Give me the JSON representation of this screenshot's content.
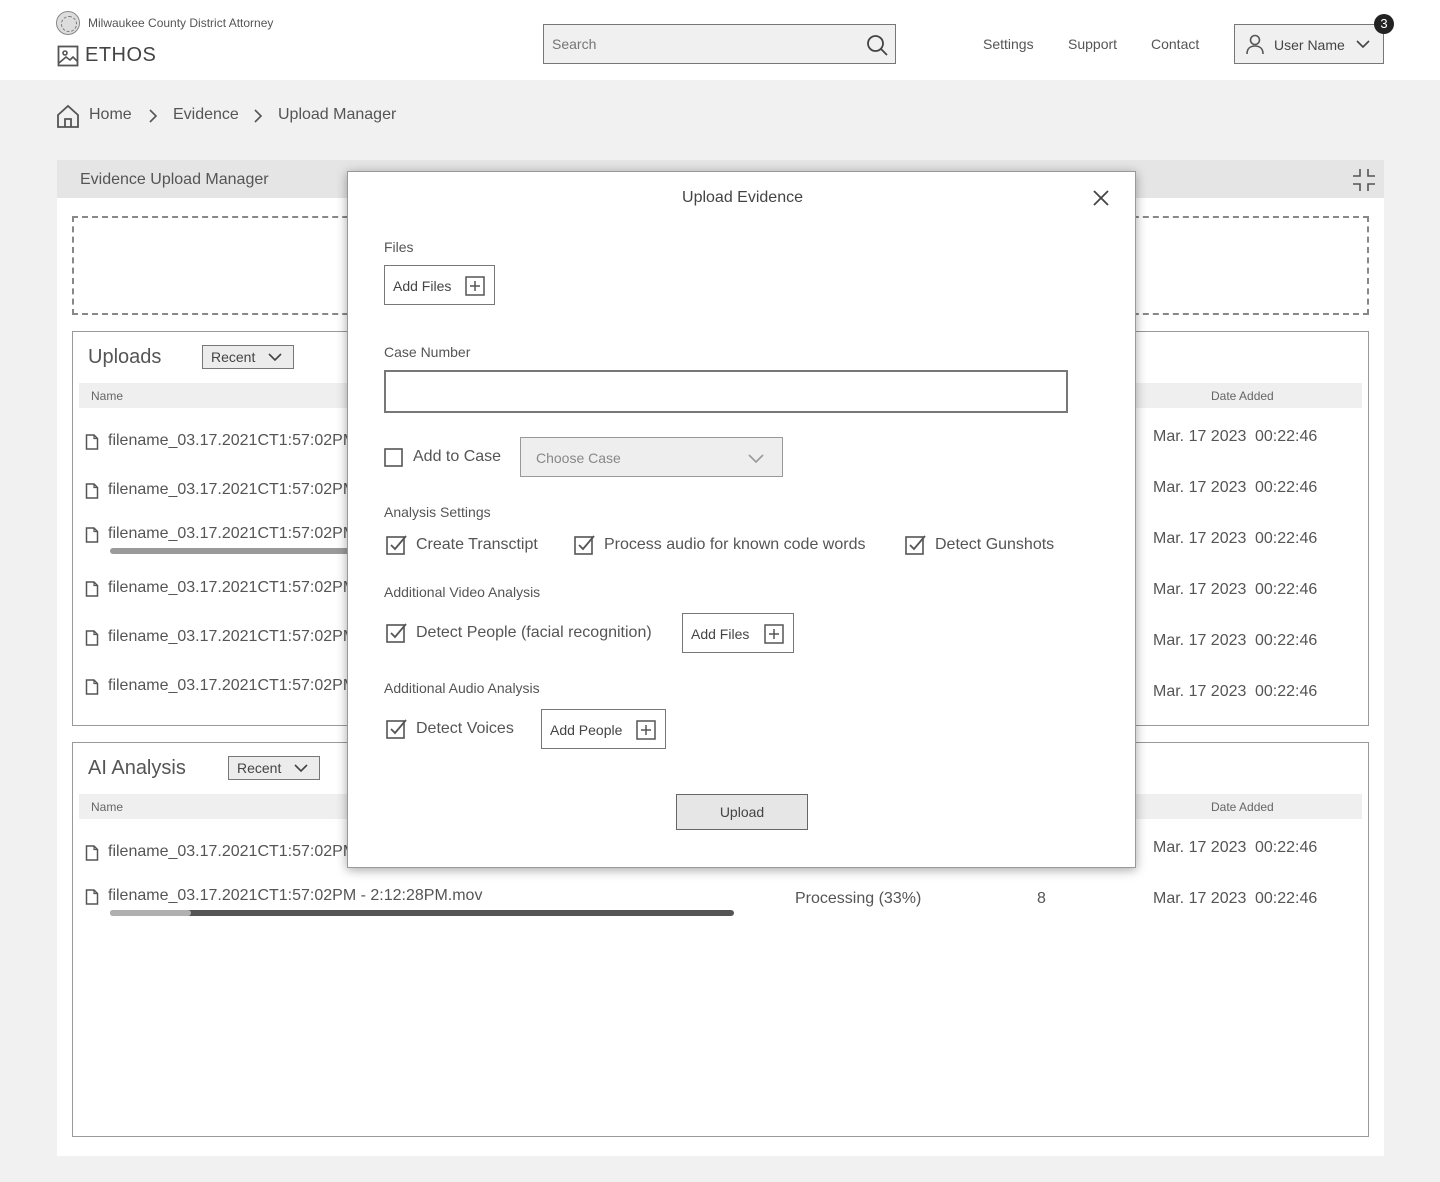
{
  "header": {
    "org_name": "Milwaukee County District Attorney",
    "app_name": "ETHOS",
    "search_placeholder": "Search",
    "nav": [
      "Settings",
      "Support",
      "Contact"
    ],
    "user_name": "User Name",
    "notification_count": "3"
  },
  "breadcrumb": [
    "Home",
    "Evidence",
    "Upload Manager"
  ],
  "panel": {
    "title": "Evidence Upload Manager"
  },
  "uploads": {
    "title": "Uploads",
    "filter": "Recent",
    "col_name": "Name",
    "col_date": "Date Added",
    "rows": [
      {
        "name": "filename_03.17.2021CT1:57:02PM",
        "date": "Mar. 17 2023",
        "time": "00:22:46"
      },
      {
        "name": "filename_03.17.2021CT1:57:02PM",
        "date": "Mar. 17 2023",
        "time": "00:22:46"
      },
      {
        "name": "filename_03.17.2021CT1:57:02PM",
        "date": "Mar. 17 2023",
        "time": "00:22:46",
        "progress": 0.5
      },
      {
        "name": "filename_03.17.2021CT1:57:02PM",
        "date": "Mar. 17 2023",
        "time": "00:22:46"
      },
      {
        "name": "filename_03.17.2021CT1:57:02PM",
        "date": "Mar. 17 2023",
        "time": "00:22:46"
      },
      {
        "name": "filename_03.17.2021CT1:57:02PM",
        "date": "Mar. 17 2023",
        "time": "00:22:46"
      }
    ]
  },
  "ai_analysis": {
    "title": "AI Analysis",
    "filter": "Recent",
    "col_name": "Name",
    "col_date": "Date Added",
    "rows": [
      {
        "name": "filename_03.17.2021CT1:57:02PM",
        "date": "Mar. 17 2023",
        "time": "00:22:46"
      },
      {
        "name": "filename_03.17.2021CT1:57:02PM - 2:12:28PM.mov",
        "status": "Processing (33%)",
        "count": "8",
        "date": "Mar. 17 2023",
        "time": "00:22:46",
        "progress": 0.33
      }
    ]
  },
  "modal": {
    "title": "Upload Evidence",
    "files_label": "Files",
    "add_files": "Add Files",
    "case_number_label": "Case Number",
    "case_number_value": "",
    "add_to_case_label": "Add to Case",
    "add_to_case_checked": false,
    "choose_case_placeholder": "Choose Case",
    "analysis_settings_label": "Analysis Settings",
    "analysis_options": [
      {
        "label": "Create Transctipt",
        "checked": true
      },
      {
        "label": "Process audio for known code words",
        "checked": true
      },
      {
        "label": "Detect Gunshots",
        "checked": true
      }
    ],
    "video_label": "Additional Video Analysis",
    "video_option": {
      "label": "Detect People (facial recognition)",
      "checked": true
    },
    "video_add_files": "Add Files",
    "audio_label": "Additional Audio Analysis",
    "audio_option": {
      "label": "Detect Voices",
      "checked": true
    },
    "audio_add_people": "Add People",
    "upload_button": "Upload"
  }
}
